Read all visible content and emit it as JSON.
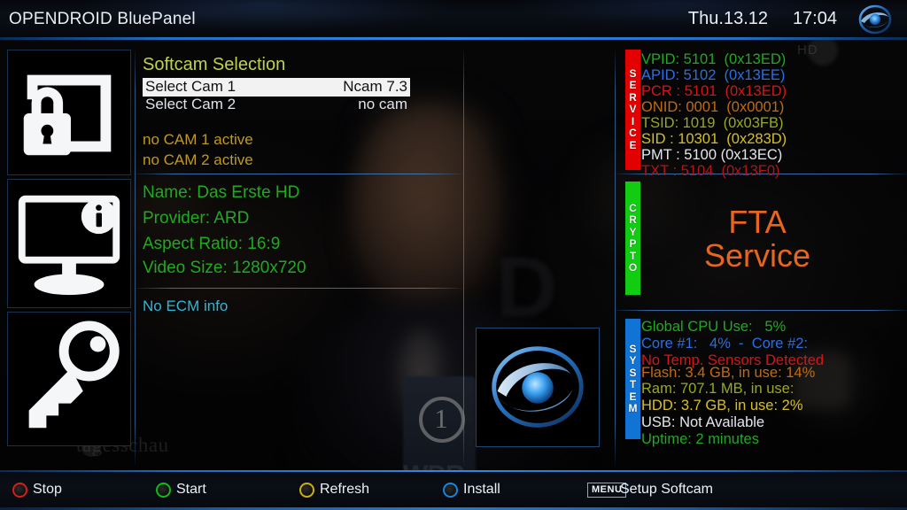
{
  "header": {
    "title": "OPENDROID BluePanel",
    "date": "Thu.13.12",
    "time": "17:04",
    "logo_icon": "opendroid-eye-logo"
  },
  "sidebar": {
    "icons": [
      {
        "name": "screen-lock-icon",
        "label": "screen-lock"
      },
      {
        "name": "monitor-info-icon",
        "label": "monitor-info"
      },
      {
        "name": "key-icon",
        "label": "key"
      }
    ]
  },
  "softcam": {
    "title": "Softcam Selection",
    "rows": [
      {
        "label": "Select Cam 1",
        "value": "Ncam 7.3",
        "selected": true
      },
      {
        "label": "Select Cam 2",
        "value": "no cam",
        "selected": false
      }
    ],
    "status": [
      "no CAM 1 active",
      "no CAM 2 active"
    ]
  },
  "service_info": {
    "name": "Name: Das Erste HD",
    "provider": "Provider: ARD",
    "aspect_ratio": "Aspect Ratio: 16:9",
    "video_size": "Video Size: 1280x720",
    "ecm": "No ECM info"
  },
  "center_logo": {
    "icon": "opendroid-eye-logo"
  },
  "service_panel": {
    "bar_label": "SERVICE",
    "bar_color": "#e20000",
    "lines": [
      {
        "text": "VPID: 5101  (0x13ED)",
        "color": "#1faa1f"
      },
      {
        "text": "APID: 5102  (0x13EE)",
        "color": "#2a6fe0"
      },
      {
        "text": "PCR : 5101  (0x13ED)",
        "color": "#d41616"
      },
      {
        "text": "ONID: 0001  (0x0001)",
        "color": "#c36a12"
      },
      {
        "text": "TSID: 1019  (0x03FB)",
        "color": "#9aa81c"
      },
      {
        "text": "SID : 10301  (0x283D)",
        "color": "#d6c024"
      },
      {
        "text": "PMT : 5100 (0x13EC)",
        "color": "#e3e7ec"
      },
      {
        "text": "TXT : 5104  (0x13F0)",
        "color": "#b01515"
      }
    ]
  },
  "crypto_panel": {
    "bar_label": "CRYPTO",
    "bar_color": "#12cc12",
    "line1": "FTA",
    "line2": "Service",
    "text_color": "#e8651f"
  },
  "system_panel": {
    "bar_label": "SYSTEM",
    "bar_color": "#1173d4",
    "lines": [
      {
        "text": "Global CPU Use:   5%",
        "color": "#1faa1f"
      },
      {
        "text": "Core #1:   4%  -  Core #2:",
        "color": "#2a6fe0"
      },
      {
        "text": "No Temp. Sensors Detected",
        "color": "#d41616"
      },
      {
        "text": "Flash: 3.4 GB, in use: 14%",
        "color": "#c36a12"
      },
      {
        "text": "Ram: 707.1 MB, in use:",
        "color": "#9aa81c"
      },
      {
        "text": "HDD: 3.7 GB, in use: 2%",
        "color": "#d6c024"
      },
      {
        "text": "USB: Not Available",
        "color": "#e3e7ec"
      },
      {
        "text": "Uptime: 2 minutes",
        "color": "#1faa1f"
      }
    ]
  },
  "footer": {
    "buttons": [
      {
        "label": "Stop",
        "color": "#d02020"
      },
      {
        "label": "Start",
        "color": "#16b816"
      },
      {
        "label": "Refresh",
        "color": "#c9b017"
      },
      {
        "label": "Install",
        "color": "#1a84d6"
      }
    ],
    "menu_key": "MENU",
    "menu_label": "Setup Softcam"
  },
  "overlay_marks": {
    "channel_logo": "1",
    "broadcaster_watermark": "WDR",
    "program_watermark": "tagesschau",
    "hd_mark": "HD"
  }
}
